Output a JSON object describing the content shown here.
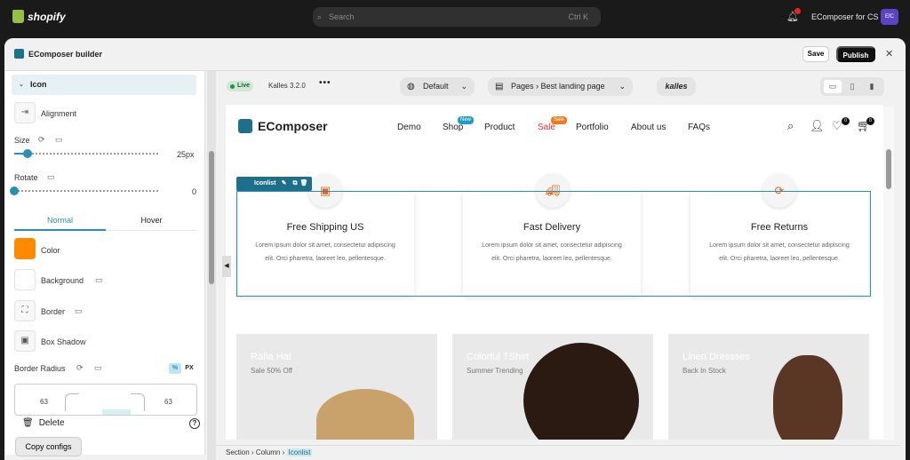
{
  "topbar": {
    "brand": "shopify",
    "search_placeholder": "Search",
    "shortcut": "Ctrl K",
    "notification_count": "1",
    "store_name": "EComposer for CS",
    "avatar_initials": "EfC"
  },
  "window": {
    "title": "EComposer builder",
    "save_label": "Save",
    "publish_label": "Publish",
    "close_glyph": "✕"
  },
  "panel": {
    "section_title": "Icon",
    "alignment_label": "Alignment",
    "size_label": "Size",
    "size_value": "25px",
    "size_fraction": 0.09,
    "rotate_label": "Rotate",
    "rotate_value": "0",
    "rotate_fraction": 0,
    "tabs": [
      "Normal",
      "Hover"
    ],
    "active_tab": "Normal",
    "color_label": "Color",
    "color_value": "#ff8a00",
    "background_label": "Background",
    "border_label": "Border",
    "box_shadow_label": "Box Shadow",
    "border_radius_label": "Border Radius",
    "unit_percent": "%",
    "unit_px": "PX",
    "radius_top_left": "63",
    "radius_top_right": "63",
    "delete_label": "Delete",
    "help_glyph": "?",
    "copy_configs_label": "Copy configs"
  },
  "canvas_toolbar": {
    "live_label": "Live",
    "theme_version": "Kalles 3.2.0",
    "more_glyph": "•••",
    "device_option": "Default",
    "pages_label": "Pages",
    "page_name": "Best landing page",
    "theme_logo": "kalles"
  },
  "site": {
    "brand": "EComposer",
    "nav": [
      {
        "label": "Demo"
      },
      {
        "label": "Shop",
        "badge": "New"
      },
      {
        "label": "Product"
      },
      {
        "label": "Sale",
        "badge": "Sale"
      },
      {
        "label": "Portfolio"
      },
      {
        "label": "About us"
      },
      {
        "label": "FAQs"
      }
    ],
    "wishlist_count": "0",
    "cart_count": "0",
    "selection_tag": "Iconlist",
    "features": [
      {
        "title": "Free Shipping US",
        "desc": "Lorem ipsum dolor sit amet, consectetur adipiscing elit. Orci pharetra, laoreet leo, pellentesque."
      },
      {
        "title": "Fast Delivery",
        "desc": "Lorem ipsum dolor sit amet, consectetur adipiscing elit. Orci pharetra, laoreet leo, pellentesque."
      },
      {
        "title": "Free Returns",
        "desc": "Lorem ipsum dolor sit amet, consectetur adipiscing elit. Orci pharetra, laoreet leo, pellentesque."
      }
    ],
    "products": [
      {
        "title": "Rafia Hat",
        "sub": "Sale 50% Off"
      },
      {
        "title": "Colorful TShirt",
        "sub": "Summer Trending"
      },
      {
        "title": "Linen Dressses",
        "sub": "Back In Stock"
      }
    ]
  },
  "breadcrumb": {
    "items": [
      "Section",
      "Column",
      "Iconlist"
    ]
  },
  "colors": {
    "accent": "#2b8fb0",
    "icon_orange": "#ff8a00",
    "sale_red": "#e0322e",
    "new_badge": "#1e9fc0",
    "sale_badge": "#ef7a1e"
  }
}
